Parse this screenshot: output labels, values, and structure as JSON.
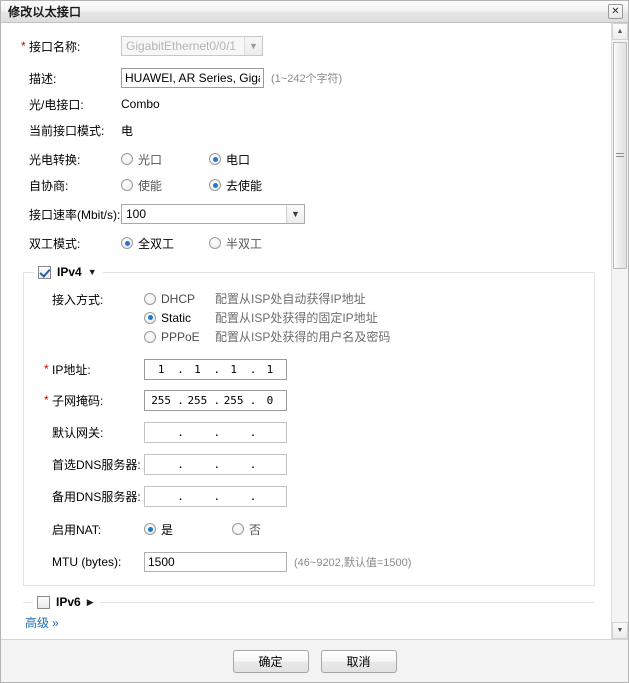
{
  "window": {
    "title": "修改以太接口",
    "close_icon": "close-icon"
  },
  "form": {
    "interface_name": {
      "label": "接口名称:",
      "value": "GigabitEthernet0/0/1",
      "required": true,
      "disabled": true
    },
    "description": {
      "label": "描述:",
      "value": "HUAWEI, AR Series, Gigal",
      "hint": "(1~242个字符)"
    },
    "optical_electrical_port": {
      "label": "光/电接口:",
      "value": "Combo"
    },
    "current_mode": {
      "label": "当前接口模式:",
      "value": "电"
    },
    "photoelectric_switch": {
      "label": "光电转换:",
      "options": [
        "光口",
        "电口"
      ],
      "selected": "电口"
    },
    "auto_negotiation": {
      "label": "自协商:",
      "options": [
        "使能",
        "去使能"
      ],
      "selected": "去使能"
    },
    "speed": {
      "label": "接口速率(Mbit/s):",
      "value": "100"
    },
    "duplex": {
      "label": "双工模式:",
      "options": [
        "全双工",
        "半双工"
      ],
      "selected": "全双工"
    }
  },
  "ipv4": {
    "title": "IPv4",
    "checked": true,
    "expanded": true,
    "toggle_icon": "triangle-down-icon",
    "access_method": {
      "label": "接入方式:",
      "selected": "Static",
      "options": [
        {
          "name": "DHCP",
          "desc": "配置从ISP处自动获得IP地址"
        },
        {
          "name": "Static",
          "desc": "配置从ISP处获得的固定IP地址"
        },
        {
          "name": "PPPoE",
          "desc": "配置从ISP处获得的用户名及密码"
        }
      ]
    },
    "ip_address": {
      "label": "IP地址:",
      "required": true,
      "octets": [
        "1",
        "1",
        "1",
        "1"
      ]
    },
    "subnet_mask": {
      "label": "子网掩码:",
      "required": true,
      "octets": [
        "255",
        "255",
        "255",
        "0"
      ]
    },
    "default_gateway": {
      "label": "默认网关:",
      "octets": [
        "",
        "",
        "",
        ""
      ]
    },
    "primary_dns": {
      "label": "首选DNS服务器:",
      "octets": [
        "",
        "",
        "",
        ""
      ]
    },
    "secondary_dns": {
      "label": "备用DNS服务器:",
      "octets": [
        "",
        "",
        "",
        ""
      ]
    },
    "enable_nat": {
      "label": "启用NAT:",
      "options": [
        "是",
        "否"
      ],
      "selected": "是"
    },
    "mtu": {
      "label": "MTU (bytes):",
      "value": "1500",
      "hint": "(46~9202,默认值=1500)"
    }
  },
  "ipv6": {
    "title": "IPv6",
    "checked": false,
    "expanded": false,
    "toggle_icon": "triangle-right-icon"
  },
  "advanced_link": {
    "label": "高级",
    "chevron": "»"
  },
  "footer": {
    "ok_label": "确定",
    "cancel_label": "取消"
  },
  "scrollbar": {
    "up_icon": "caret-up-icon",
    "down_icon": "caret-down-icon"
  }
}
